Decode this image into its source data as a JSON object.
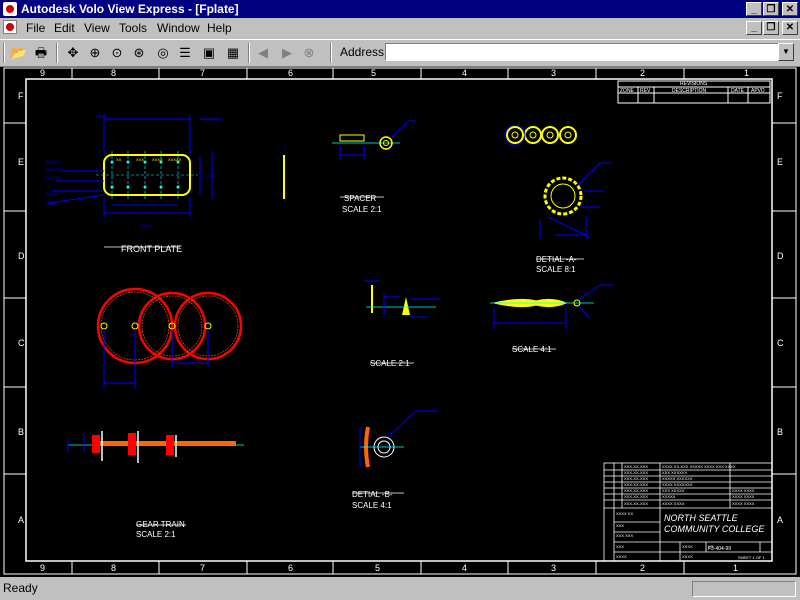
{
  "window": {
    "title": "Autodesk Volo View Express - [Fplate]"
  },
  "menu": [
    "File",
    "Edit",
    "View",
    "Tools",
    "Window",
    "Help"
  ],
  "toolbar": {
    "buttons": [
      "open-icon",
      "print-icon",
      "pan-icon",
      "zoom-realtime-icon",
      "zoom-window-icon",
      "zoom-extents-icon",
      "orbit-icon",
      "layers-icon",
      "views-icon",
      "grid-icon",
      "back-icon",
      "forward-icon",
      "stop-icon"
    ]
  },
  "address": {
    "label": "Address:",
    "value": ""
  },
  "drawing": {
    "column_labels": [
      "9",
      "8",
      "7",
      "6",
      "5",
      "4",
      "3",
      "2",
      "1"
    ],
    "row_labels": [
      "F",
      "E",
      "D",
      "C",
      "B",
      "A"
    ],
    "views": {
      "front_plate": "FRONT PLATE",
      "spacer": "SPACER",
      "spacer_scale": "SCALE 2:1",
      "detail_a": "DETIAL -A-",
      "detail_a_scale": "SCALE 8:1",
      "scale_24": "SCALE 2:1",
      "scale_41": "SCALE 4:1",
      "gear_train": "GEAR TRAIN",
      "gear_train_scale": "SCALE 2:1",
      "detail_b": "DETIAL -B-",
      "detail_b_scale": "SCALE 4:1"
    },
    "revisions": {
      "title": "REVISIONS",
      "headers": [
        "ZONE",
        "REV",
        "DESCRIPTION",
        "DATE",
        "APVD"
      ]
    },
    "title_block": {
      "school_line1": "NORTH SEATTLE",
      "school_line2": "COMMUNITY COLLEGE",
      "drawing_no": "F3-404-99",
      "sheet": "SHEET 1 OF 1"
    },
    "colors": {
      "front_plate": "#ffff00",
      "gears": "#ff0000",
      "dimensions": "#0000ff",
      "border": "#ffffff",
      "leaders": "#00ff00"
    }
  },
  "status": {
    "text": "Ready"
  }
}
